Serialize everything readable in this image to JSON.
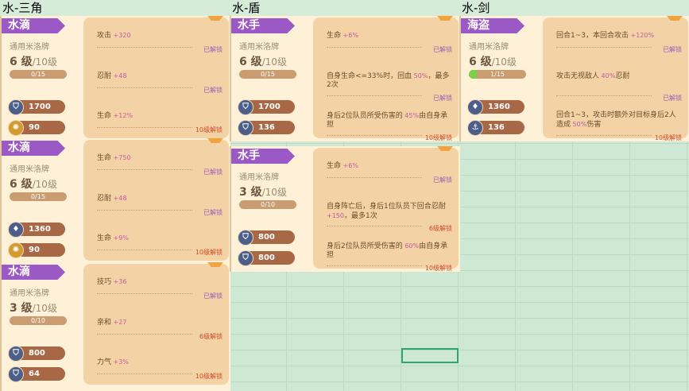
{
  "headers": [
    "水-三角",
    "水-盾",
    "水-剑"
  ],
  "cards": [
    {
      "name": "水滴",
      "type_label": "通用米洛牌",
      "level": "6 级",
      "max_level": "/10级",
      "exp_text": "0/15",
      "exp_fraction": 0,
      "stats": [
        {
          "icon": "shield-icon",
          "value": "1700"
        },
        {
          "icon": "gear-icon",
          "value": "90"
        }
      ],
      "skills": [
        {
          "text": "攻击",
          "bonus": "+320",
          "status": "已解锁"
        },
        {
          "text": "忍耐",
          "bonus": "+48",
          "status": "已解锁"
        },
        {
          "text": "生命",
          "bonus": "+12%",
          "status": "10级解锁"
        }
      ]
    },
    {
      "name": "水滴",
      "type_label": "通用米洛牌",
      "level": "6 级",
      "max_level": "/10级",
      "exp_text": "0/15",
      "exp_fraction": 0,
      "stats": [
        {
          "icon": "drop-icon",
          "value": "1360"
        },
        {
          "icon": "gear-icon",
          "value": "90"
        }
      ],
      "skills": [
        {
          "text": "生命",
          "bonus": "+750",
          "status": "已解锁"
        },
        {
          "text": "忍耐",
          "bonus": "+48",
          "status": "已解锁"
        },
        {
          "text": "生命",
          "bonus": "+9%",
          "status": "10级解锁"
        }
      ]
    },
    {
      "name": "水滴",
      "type_label": "通用米洛牌",
      "level": "3 级",
      "max_level": "/10级",
      "exp_text": "0/10",
      "exp_fraction": 0,
      "stats": [
        {
          "icon": "shield-icon",
          "value": "800"
        },
        {
          "icon": "shield-icon",
          "value": "64"
        }
      ],
      "skills": [
        {
          "text": "技巧",
          "bonus": "+36",
          "status": "已解锁"
        },
        {
          "text": "亲和",
          "bonus": "+27",
          "status": "6级解锁"
        },
        {
          "text": "力气",
          "bonus": "+3%",
          "status": "10级解锁"
        }
      ]
    },
    {
      "name": "水手",
      "type_label": "通用米洛牌",
      "level": "6 级",
      "max_level": "/10级",
      "exp_text": "0/15",
      "exp_fraction": 0,
      "stats": [
        {
          "icon": "shield-icon",
          "value": "1700"
        },
        {
          "icon": "shield-icon",
          "value": "136"
        }
      ],
      "skills": [
        {
          "text": "生命",
          "bonus": "+6%",
          "status": "已解锁"
        },
        {
          "text": "自身生命<=33%时，回血",
          "bonus": "50%",
          "tail": "，最多2次",
          "status": "已解锁"
        },
        {
          "text": "身后2位队员所受伤害的",
          "bonus": "45%",
          "tail": "由自身承担",
          "status": "10级解锁"
        }
      ]
    },
    {
      "name": "水手",
      "type_label": "通用米洛牌",
      "level": "3 级",
      "max_level": "/10级",
      "exp_text": "0/10",
      "exp_fraction": 0,
      "stats": [
        {
          "icon": "shield-icon",
          "value": "800"
        },
        {
          "icon": "shield-icon",
          "value": "800"
        }
      ],
      "skills": [
        {
          "text": "生命",
          "bonus": "+6%",
          "status": "已解锁"
        },
        {
          "text": "自身阵亡后，身后1位队员下回合忍耐",
          "bonus": "+150",
          "tail": "，最多1次",
          "status": "6级解锁"
        },
        {
          "text": "身后2位队员所受伤害的",
          "bonus": "60%",
          "tail": "由自身承担",
          "status": "10级解锁"
        }
      ]
    },
    {
      "name": "海盗",
      "type_label": "通用米洛牌",
      "level": "6 级",
      "max_level": "/10级",
      "exp_text": "1/15",
      "exp_fraction": 0.067,
      "stats": [
        {
          "icon": "drop-icon",
          "value": "1360"
        },
        {
          "icon": "anchor-icon",
          "value": "136"
        }
      ],
      "skills": [
        {
          "text": "回合1~3，本回合攻击",
          "bonus": "+120%",
          "status": "已解锁"
        },
        {
          "text": "攻击无视敌人",
          "bonus": "40%",
          "tail": "忍耐",
          "status": "已解锁"
        },
        {
          "text": "回合1~3，攻击时额外对目标身后2人造成",
          "bonus": "50%",
          "tail": "伤害",
          "status": "10级解锁"
        }
      ]
    }
  ]
}
